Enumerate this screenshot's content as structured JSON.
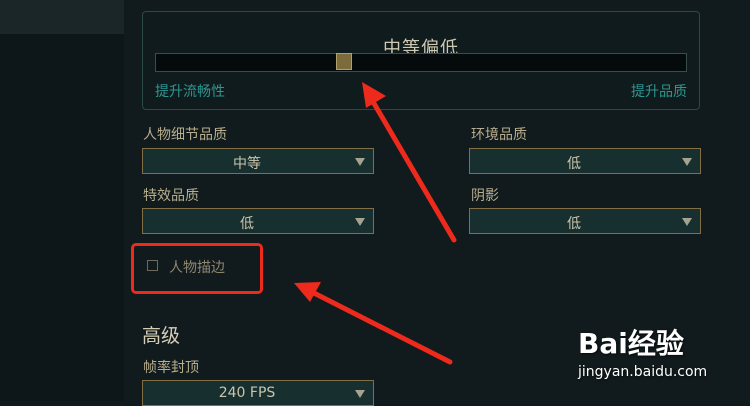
{
  "quality_preset": {
    "title": "中等偏低",
    "level": 0.35,
    "left_label": "提升流畅性",
    "right_label": "提升品质"
  },
  "settings": {
    "character_detail": {
      "label": "人物细节品质",
      "value": "中等"
    },
    "environment": {
      "label": "环境品质",
      "value": "低"
    },
    "effects": {
      "label": "特效品质",
      "value": "低"
    },
    "shadows": {
      "label": "阴影",
      "value": "低"
    },
    "outline": {
      "label": "人物描边",
      "checked": false
    }
  },
  "advanced": {
    "title": "高级",
    "frame_rate": {
      "label": "帧率封顶",
      "value": "240 FPS"
    }
  },
  "watermark": {
    "logo_text": "Bai经验",
    "url": "jingyan.baidu.com"
  },
  "colors": {
    "accent_teal": "#2e9690",
    "gold_border": "#826f45",
    "annotation_red": "#ee2a1d"
  }
}
